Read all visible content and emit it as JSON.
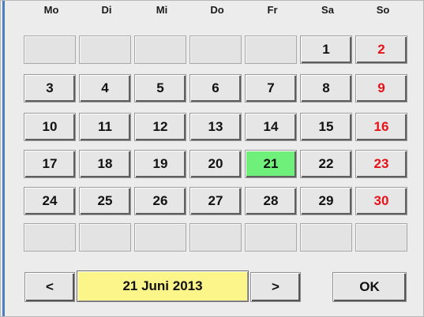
{
  "weekdays": [
    "Mo",
    "Di",
    "Mi",
    "Do",
    "Fr",
    "Sa",
    "So"
  ],
  "weeks": [
    [
      "",
      "",
      "",
      "",
      "",
      "1",
      "2"
    ],
    [
      "3",
      "4",
      "5",
      "6",
      "7",
      "8",
      "9"
    ],
    [
      "10",
      "11",
      "12",
      "13",
      "14",
      "15",
      "16"
    ],
    [
      "17",
      "18",
      "19",
      "20",
      "21",
      "22",
      "23"
    ],
    [
      "24",
      "25",
      "26",
      "27",
      "28",
      "29",
      "30"
    ],
    [
      "",
      "",
      "",
      "",
      "",
      "",
      ""
    ]
  ],
  "selected_day": "21",
  "footer": {
    "prev_label": "<",
    "date_label": "21 Juni 2013",
    "next_label": ">",
    "ok_label": "OK"
  },
  "colors": {
    "sunday_text": "#e6121a",
    "selected_bg": "#6ef07a",
    "date_bg": "#fbf58a"
  }
}
